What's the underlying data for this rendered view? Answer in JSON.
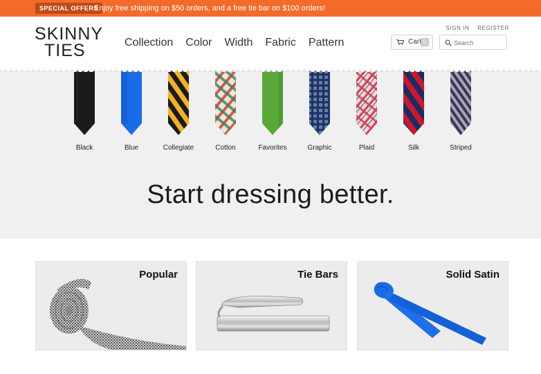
{
  "promo": {
    "badge": "Special Offers",
    "text": "Enjoy free shipping on $50 orders, and a free tie bar on $100 orders!"
  },
  "header": {
    "logo_line1": "SKINNY",
    "logo_line2": "TIES",
    "nav": [
      "Collection",
      "Color",
      "Width",
      "Fabric",
      "Pattern"
    ],
    "sign_in": "SIGN IN",
    "register": "REGISTER",
    "cart_label": "Cart",
    "cart_count": "0",
    "search_placeholder": "Search"
  },
  "hero": {
    "categories": [
      {
        "label": "Black",
        "icon": "black-tie-icon",
        "color": "#1b1b1b"
      },
      {
        "label": "Blue",
        "icon": "blue-tie-icon",
        "color": "#1a6be6"
      },
      {
        "label": "Collegiate",
        "icon": "collegiate-tie-icon",
        "color": "#f2b12a"
      },
      {
        "label": "Cotton",
        "icon": "cotton-tie-icon",
        "color": "#d45a4c"
      },
      {
        "label": "Favorites",
        "icon": "favorites-tie-icon",
        "color": "#5aa83a"
      },
      {
        "label": "Graphic",
        "icon": "graphic-tie-icon",
        "color": "#1d3668"
      },
      {
        "label": "Plaid",
        "icon": "plaid-tie-icon",
        "color": "#c7465a"
      },
      {
        "label": "Silk",
        "icon": "silk-tie-icon",
        "color": "#c8192f"
      },
      {
        "label": "Striped",
        "icon": "striped-tie-icon",
        "color": "#55506a"
      }
    ],
    "headline": "Start dressing better."
  },
  "cards": [
    {
      "title": "Popular",
      "icon": "rolled-tie-icon"
    },
    {
      "title": "Tie Bars",
      "icon": "tie-bar-icon"
    },
    {
      "title": "Solid Satin",
      "icon": "satin-tie-icon"
    }
  ]
}
